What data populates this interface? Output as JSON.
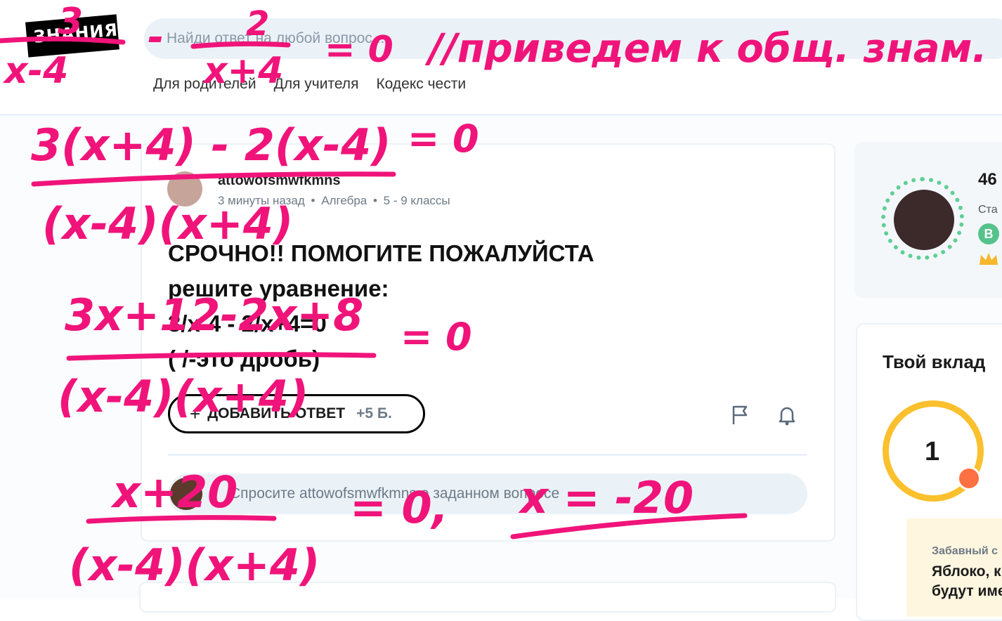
{
  "header": {
    "logo_text": "ЗНАНИЯ",
    "search_placeholder": "Найди ответ на любой вопрос...",
    "nav": [
      "Для родителей",
      "Для учителя",
      "Кодекс чести"
    ]
  },
  "question": {
    "author": "attowofsmwfkmns",
    "meta": [
      "3 минуты назад",
      "•",
      "Алгебра",
      "•",
      "5 - 9 классы"
    ],
    "text": "СРОЧНО!! ПОМОГИТЕ ПОЖАЛУЙСТА\nрешите уравнение:\n3/x-4 - 2/x+4=0\n( /-это дробь)",
    "answer_button": "ДОБАВИТЬ ОТВЕТ",
    "answer_points": "+5 Б.",
    "ask_placeholder": "Спросите attowofsmwfkmns о заданном вопросе"
  },
  "profile": {
    "points": "46",
    "status": "Ста",
    "badge": "B"
  },
  "contribution": {
    "title": "Твой вклад",
    "streak": "1",
    "fact_label": "Забавный с",
    "fact_text": "Яблоко, к\nбудут име"
  },
  "annotations": {
    "line1": [
      "3",
      "x-4",
      "-",
      "2",
      "x+4",
      "= 0",
      "//приведем к общ. знам."
    ],
    "line2": [
      "3(x+4) - 2(x-4)",
      "= 0",
      "(x-4)(x+4)"
    ],
    "line3": [
      "3x+12-2x+8",
      "= 0",
      "(x-4)(x+4)"
    ],
    "line4": [
      "x+20",
      "= 0,",
      "x = -20",
      "(x-4)(x+4)"
    ]
  },
  "colors": {
    "ink": "#f0147a",
    "accent_green": "#5fcf95",
    "streak_yellow": "#fbc02d"
  }
}
